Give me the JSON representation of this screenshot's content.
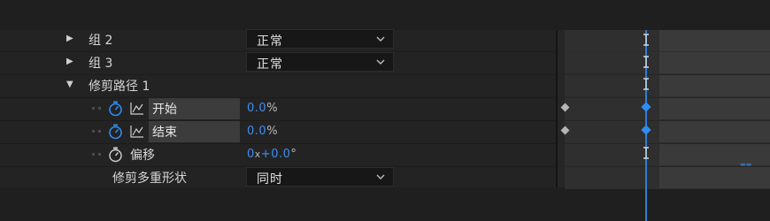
{
  "layers": [
    {
      "label": "组 2",
      "blend": "正常"
    },
    {
      "label": "组 3",
      "blend": "正常"
    }
  ],
  "trim_group": {
    "label": "修剪路径 1"
  },
  "properties": {
    "start": {
      "label": "开始",
      "value": "0.0",
      "unit": "%"
    },
    "end": {
      "label": "结束",
      "value": "0.0",
      "unit": "%"
    },
    "offset": {
      "label": "偏移",
      "revolutions": "0",
      "x_sep": "x",
      "degrees": "+0.0",
      "deg_unit": "°"
    }
  },
  "trim_multiple": {
    "label": "修剪多重形状",
    "value": "同时"
  },
  "colors": {
    "accent": "#3f8df4",
    "playhead": "#2e7ed8"
  },
  "icons": [
    "expand-triangle-icon",
    "collapse-triangle-icon",
    "stopwatch-icon",
    "graph-icon",
    "chevron-down-icon",
    "keyframe-icon",
    "i-beam-icon"
  ]
}
